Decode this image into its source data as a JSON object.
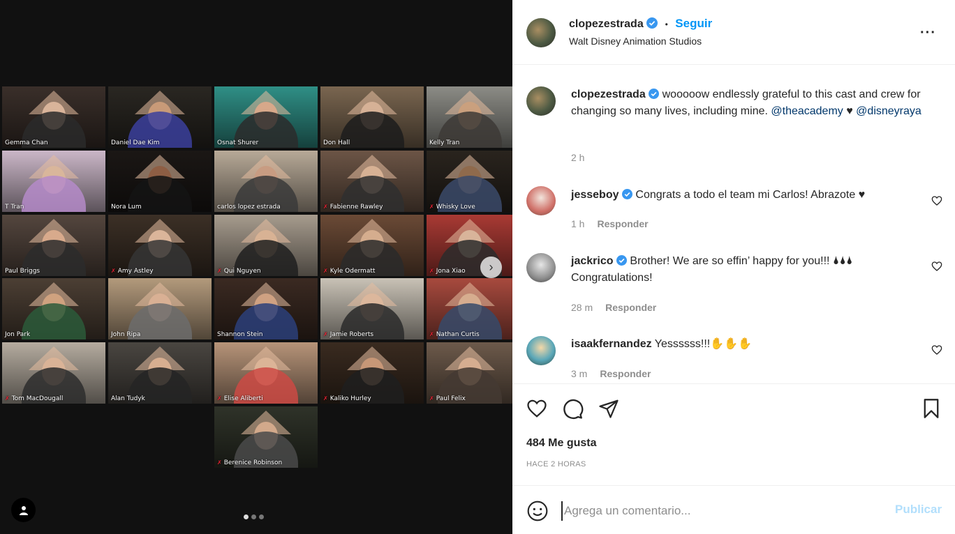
{
  "media": {
    "tiles": [
      {
        "name": "Gemma Chan",
        "bg": "#3a2f2a",
        "skin": "#d9b49a",
        "cloth": "#2a2a2a",
        "mic_off": false
      },
      {
        "name": "Daniel Dae Kim",
        "bg": "#2a2722",
        "skin": "#c89a78",
        "cloth": "#3b3f9c",
        "mic_off": false,
        "active": true
      },
      {
        "name": "Osnat Shurer",
        "bg": "#2f8f86",
        "skin": "#d7a88a",
        "cloth": "#2b2b2b",
        "mic_off": false
      },
      {
        "name": "Don Hall",
        "bg": "#7a6650",
        "skin": "#d6b196",
        "cloth": "#1c1c1c",
        "mic_off": false
      },
      {
        "name": "Kelly Tran",
        "bg": "#8c8c86",
        "skin": "#caa07e",
        "cloth": "#3d3a36",
        "mic_off": false
      },
      {
        "name": "T Tran",
        "bg": "#cbb7c8",
        "skin": "#d9b69b",
        "cloth": "#b58bc9",
        "mic_off": false
      },
      {
        "name": "Nora Lum",
        "bg": "#1b1715",
        "skin": "#8e5e44",
        "cloth": "#141414",
        "mic_off": false
      },
      {
        "name": "carlos lopez estrada",
        "bg": "#b8aa98",
        "skin": "#c89c82",
        "cloth": "#3a3a3a",
        "mic_off": false
      },
      {
        "name": "Fabienne Rawley",
        "bg": "#6c5546",
        "skin": "#d7b194",
        "cloth": "#2f2f2f",
        "mic_off": true
      },
      {
        "name": "Whisky Love",
        "bg": "#2a241e",
        "skin": "#8f6a4c",
        "cloth": "#3b4a6a",
        "mic_off": true
      },
      {
        "name": "Paul Briggs",
        "bg": "#54463e",
        "skin": "#d8aa8c",
        "cloth": "#2b2b2b",
        "mic_off": false
      },
      {
        "name": "Amy Astley",
        "bg": "#3c3026",
        "skin": "#dbb59a",
        "cloth": "#353535",
        "mic_off": true
      },
      {
        "name": "Qui Nguyen",
        "bg": "#a79c8e",
        "skin": "#d8b294",
        "cloth": "#1f1f1f",
        "mic_off": true
      },
      {
        "name": "Kyle Odermatt",
        "bg": "#6b4a36",
        "skin": "#d5ad8e",
        "cloth": "#2a2a2a",
        "mic_off": true
      },
      {
        "name": "Jona Xiao",
        "bg": "#a93a34",
        "skin": "#d8b49a",
        "cloth": "#2b2b2b",
        "mic_off": true
      },
      {
        "name": "Jon Park",
        "bg": "#4c3f34",
        "skin": "#cfa27f",
        "cloth": "#2c5a3a",
        "mic_off": false
      },
      {
        "name": "John Ripa",
        "bg": "#b39a7c",
        "skin": "#d9b094",
        "cloth": "#6c6c6c",
        "mic_off": false
      },
      {
        "name": "Shannon Stein",
        "bg": "#3b2a22",
        "skin": "#cfa182",
        "cloth": "#2b3f7a",
        "mic_off": false
      },
      {
        "name": "Jamie Roberts",
        "bg": "#c9c2b6",
        "skin": "#dcb79c",
        "cloth": "#2a2a2a",
        "mic_off": true
      },
      {
        "name": "Nathan Curtis",
        "bg": "#a84a3e",
        "skin": "#d6ad8f",
        "cloth": "#364a6a",
        "mic_off": true
      },
      {
        "name": "Tom MacDougall",
        "bg": "#b5aca0",
        "skin": "#dab397",
        "cloth": "#2d2d2d",
        "mic_off": true
      },
      {
        "name": "Alan Tudyk",
        "bg": "#4a4641",
        "skin": "#d7ae90",
        "cloth": "#242424",
        "mic_off": false
      },
      {
        "name": "Elise Aliberti",
        "bg": "#b79479",
        "skin": "#dbb497",
        "cloth": "#cc4a44",
        "mic_off": true
      },
      {
        "name": "Kaliko Hurley",
        "bg": "#3a2b20",
        "skin": "#c79777",
        "cloth": "#1e1e1e",
        "mic_off": true
      },
      {
        "name": "Paul Felix",
        "bg": "#6d5a4b",
        "skin": "#d5ad90",
        "cloth": "#443a32",
        "mic_off": true
      },
      {
        "name": "Berenice Robinson",
        "bg": "#2f3329",
        "skin": "#d2a98b",
        "cloth": "#4a4a4a",
        "mic_off": true
      }
    ],
    "mic_glyph": "✗",
    "next_glyph": "›",
    "carousel_dots": 3,
    "active_dot": 0
  },
  "header": {
    "username": "clopezestrada",
    "separator": "•",
    "follow_label": "Seguir",
    "location": "Walt Disney Animation Studios",
    "more_label": "···"
  },
  "caption": {
    "username": "clopezestrada",
    "text_before": " wooooow endlessly grateful to this cast and crew for changing so many lives, including mine. ",
    "mention1": "@theacademy",
    "heart": " ♥ ",
    "mention2": "@disneyraya",
    "time": "2 h"
  },
  "comments": [
    {
      "username": "jesseboy",
      "text": "Congrats a todo el team mi Carlos! Abrazote ♥",
      "time": "1 h",
      "reply_label": "Responder"
    },
    {
      "username": "jackrico",
      "text": "Brother! We are so effin’ happy for you!!! 🌢🌢🌢 Congratulations!",
      "time": "28 m",
      "reply_label": "Responder"
    },
    {
      "username": "isaakfernandez",
      "text": "Yessssss!!!✋✋✋",
      "time": "3 m",
      "reply_label": "Responder"
    }
  ],
  "actions": {
    "likes": "484 Me gusta",
    "posted": "HACE 2 HORAS"
  },
  "add_comment": {
    "placeholder": "Agrega un comentario...",
    "publish_label": "Publicar"
  },
  "colors": {
    "accent": "#0095f6",
    "verified": "#3897f0",
    "publish_disabled": "#b2dffc",
    "mention": "#00376b"
  }
}
